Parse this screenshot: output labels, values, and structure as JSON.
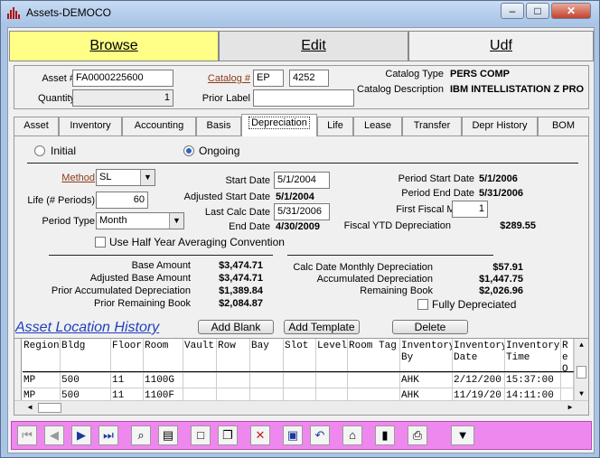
{
  "window": {
    "title": "Assets-DEMOCO",
    "min": "–",
    "max": "□",
    "close": "✕"
  },
  "main_tabs": [
    "Browse",
    "Edit",
    "Udf"
  ],
  "header": {
    "asset_label": "Asset #",
    "asset_value": "FA0000225600",
    "quantity_label": "Quantity",
    "quantity_value": "1",
    "catalog_label": "Catalog #",
    "catalog_code": "EP",
    "catalog_num": "4252",
    "prior_label": "Prior Label",
    "prior_value": "",
    "catalog_type_label": "Catalog Type",
    "catalog_type_value": "PERS COMP",
    "catalog_desc_label": "Catalog Description",
    "catalog_desc_value": "IBM INTELLISTATION Z PRO"
  },
  "sub_tabs": [
    "Asset",
    "Inventory",
    "Accounting",
    "Basis",
    "Depreciation",
    "Life",
    "Lease",
    "Transfer",
    "Depr History",
    "BOM"
  ],
  "depr": {
    "initial": "Initial",
    "ongoing": "Ongoing",
    "method_label": "Method",
    "method_value": "SL",
    "life_label": "Life (# Periods)",
    "life_value": "60",
    "period_type_label": "Period Type",
    "period_type_value": "Month",
    "half_year": "Use Half Year Averaging Convention",
    "start_date_label": "Start Date",
    "start_date_value": "5/1/2004",
    "adj_start_label": "Adjusted Start Date",
    "adj_start_value": "5/1/2004",
    "last_calc_label": "Last Calc Date",
    "last_calc_value": "5/31/2006",
    "end_date_label": "End Date",
    "end_date_value": "4/30/2009",
    "period_start_label": "Period Start Date",
    "period_start_value": "5/1/2006",
    "period_end_label": "Period End Date",
    "period_end_value": "5/31/2006",
    "first_fiscal_label": "First Fiscal Month",
    "first_fiscal_value": "1",
    "fiscal_ytd_label": "Fiscal YTD Depreciation",
    "fiscal_ytd_value": "$289.55",
    "base_amount_label": "Base Amount",
    "base_amount_value": "$3,474.71",
    "adj_base_label": "Adjusted Base Amount",
    "adj_base_value": "$3,474.71",
    "prior_accum_label": "Prior Accumulated Depreciation",
    "prior_accum_value": "$1,389.84",
    "prior_remain_label": "Prior Remaining Book",
    "prior_remain_value": "$2,084.87",
    "calc_monthly_label": "Calc Date Monthly Depreciation",
    "calc_monthly_value": "$57.91",
    "accum_label": "Accumulated Depreciation",
    "accum_value": "$1,447.75",
    "remain_label": "Remaining Book",
    "remain_value": "$2,026.96",
    "fully_label": "Fully Depreciated"
  },
  "location": {
    "title": "Asset Location History",
    "add_blank": "Add Blank",
    "add_template": "Add Template",
    "delete": "Delete",
    "columns": [
      "Region",
      "Bldg",
      "Floor",
      "Room",
      "Vault",
      "Row",
      "Bay",
      "Slot",
      "Level",
      "Room Tag",
      "Inventory By",
      "Inventory Date",
      "Inventory Time",
      "Re Or O"
    ],
    "rows": [
      [
        "MP",
        "500",
        "11",
        "1100G",
        "",
        "",
        "",
        "",
        "",
        "",
        "AHK",
        "2/12/200",
        "15:37:00",
        ""
      ],
      [
        "MP",
        "500",
        "11",
        "1100F",
        "",
        "",
        "",
        "",
        "",
        "",
        "AHK",
        "11/19/20",
        "14:11:00",
        ""
      ]
    ]
  },
  "colors": {
    "browse_tab": "#ffff88",
    "toolbar": "#ef88ee",
    "link": "#1f3fbf"
  }
}
